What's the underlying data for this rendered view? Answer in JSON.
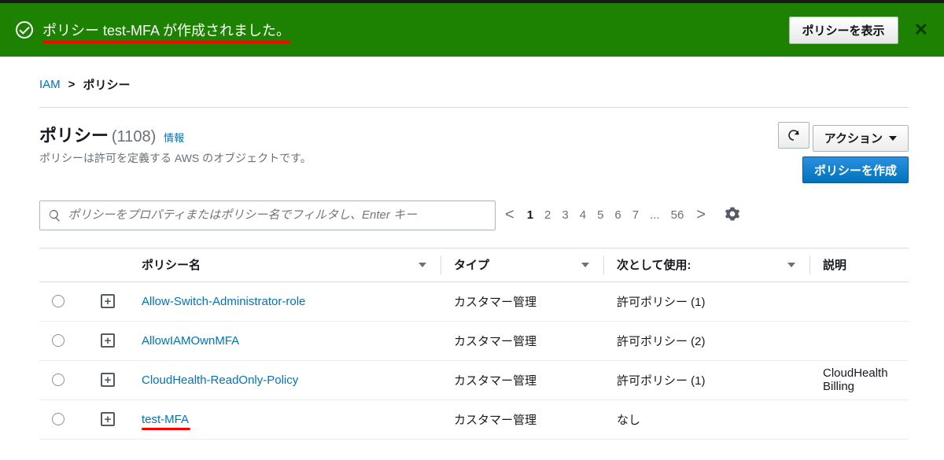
{
  "banner": {
    "message": "ポリシー test-MFA が作成されました。",
    "view_btn": "ポリシーを表示"
  },
  "breadcrumb": {
    "root": "IAM",
    "current": "ポリシー"
  },
  "header": {
    "title": "ポリシー",
    "count": "(1108)",
    "info": "情報",
    "subtitle": "ポリシーは許可を定義する AWS のオブジェクトです。",
    "actions_btn": "アクション",
    "create_btn": "ポリシーを作成"
  },
  "search": {
    "placeholder": "ポリシーをプロパティまたはポリシー名でフィルタし、Enter キー"
  },
  "pagination": {
    "pages": [
      "1",
      "2",
      "3",
      "4",
      "5",
      "6",
      "7",
      "...",
      "56"
    ],
    "current": "1"
  },
  "table": {
    "headers": {
      "name": "ポリシー名",
      "type": "タイプ",
      "used": "次として使用:",
      "desc": "説明"
    },
    "rows": [
      {
        "name": "Allow-Switch-Administrator-role",
        "type": "カスタマー管理",
        "used": "許可ポリシー (1)",
        "desc": "",
        "hl": false
      },
      {
        "name": "AllowIAMOwnMFA",
        "type": "カスタマー管理",
        "used": "許可ポリシー (2)",
        "desc": "",
        "hl": false
      },
      {
        "name": "CloudHealth-ReadOnly-Policy",
        "type": "カスタマー管理",
        "used": "許可ポリシー (1)",
        "desc": "CloudHealth Billing",
        "hl": false
      },
      {
        "name": "test-MFA",
        "type": "カスタマー管理",
        "used": "なし",
        "desc": "",
        "hl": true
      }
    ]
  }
}
